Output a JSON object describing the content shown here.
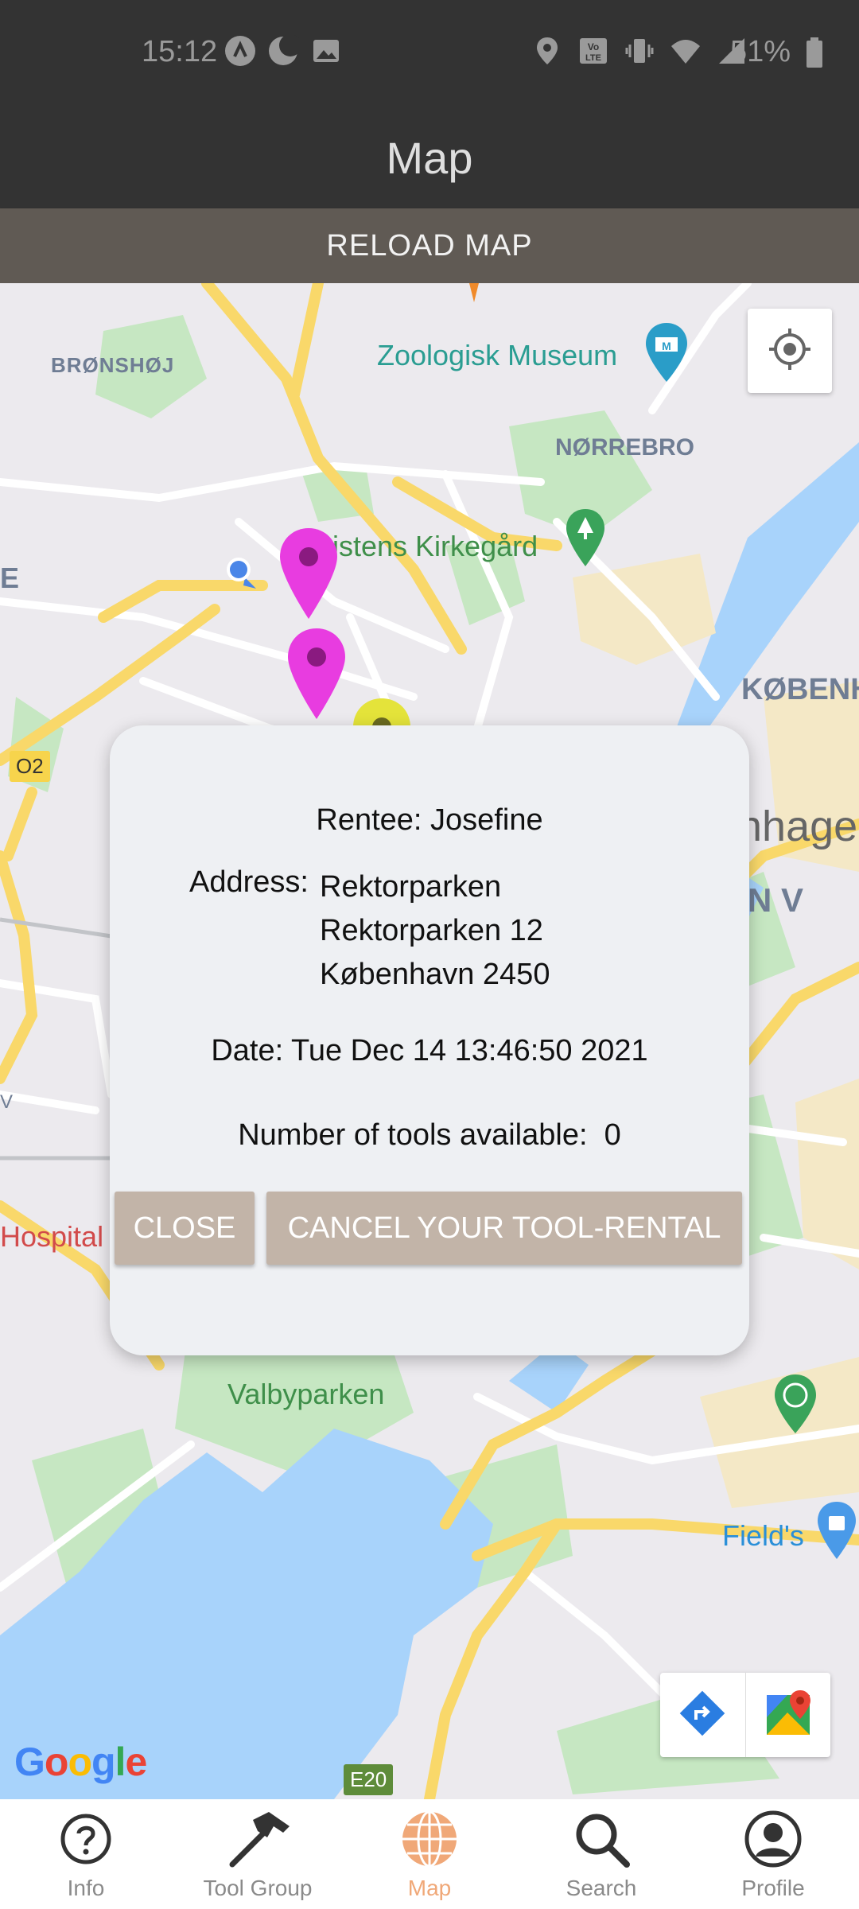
{
  "status_bar": {
    "time": "15:12",
    "battery": "51%",
    "icons": [
      "notification-a-icon",
      "moon-icon",
      "image-icon",
      "location-icon",
      "volte-icon",
      "vibrate-icon",
      "wifi-icon",
      "signal-icon",
      "battery-icon"
    ]
  },
  "header": {
    "title": "Map"
  },
  "reload_button": {
    "label": "RELOAD MAP"
  },
  "map": {
    "labels": {
      "bronshoj": "BRØNSHØJ",
      "zoologisk": "Zoologisk Museum",
      "norrebro": "NØRREBRO",
      "assistens": "istens Kirkegård",
      "e_edge": "E",
      "kobenh": "KØBENH",
      "hagen": "nhagen",
      "nv": "N V",
      "hospital": "Hospital",
      "v_edge": "V",
      "valbyparken": "Valbyparken",
      "fields": "Field's",
      "o2": "O2",
      "e20": "E20",
      "google": "Google"
    },
    "colors": {
      "pin_magenta": "#e83ce0",
      "pin_yellow": "#e4e33a",
      "water": "#a8d3fb",
      "park": "#c8e6c0",
      "road": "#f9d86a"
    }
  },
  "dialog": {
    "rentee_label": "Rentee:",
    "rentee_value": "Josefine",
    "address_label": "Address:",
    "address_lines": [
      "Rektorparken",
      "Rektorparken 12",
      "København 2450"
    ],
    "date_label": "Date:",
    "date_value": "Tue Dec 14 13:46:50 2021",
    "tools_label": "Number of tools available:",
    "tools_value": "0",
    "close_label": "CLOSE",
    "cancel_label": "CANCEL YOUR TOOL-RENTAL"
  },
  "nav": {
    "items": [
      {
        "label": "Info",
        "icon": "question-circle-icon",
        "active": false
      },
      {
        "label": "Tool Group",
        "icon": "hammer-icon",
        "active": false
      },
      {
        "label": "Map",
        "icon": "globe-icon",
        "active": true
      },
      {
        "label": "Search",
        "icon": "search-icon",
        "active": false
      },
      {
        "label": "Profile",
        "icon": "user-circle-icon",
        "active": false
      }
    ],
    "active_color": "#f0a878"
  }
}
